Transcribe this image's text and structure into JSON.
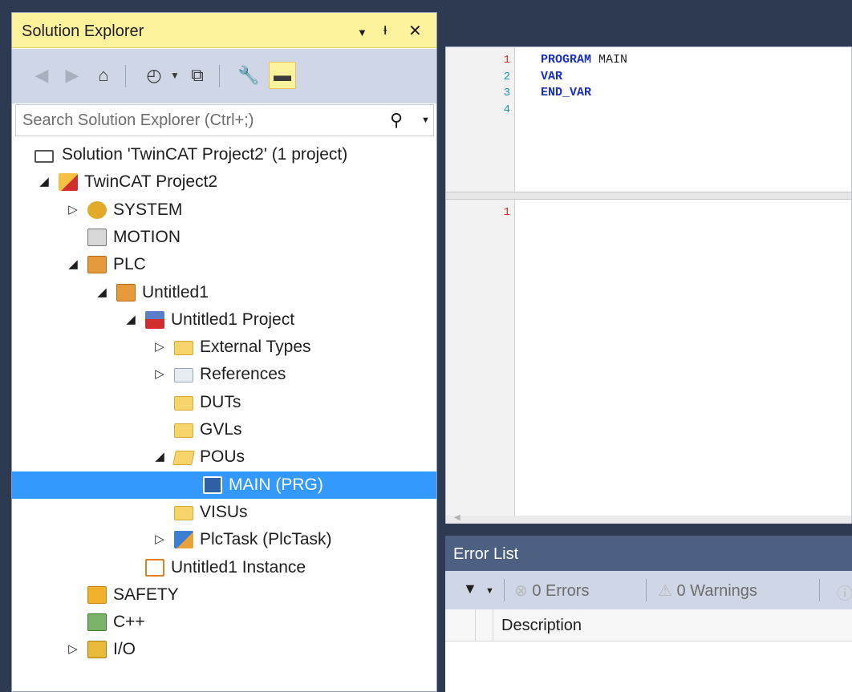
{
  "solution_explorer": {
    "title": "Solution Explorer",
    "search": {
      "placeholder": "Search Solution Explorer (Ctrl+;)"
    },
    "tree": [
      {
        "label": "Solution 'TwinCAT Project2' (1 project)",
        "icon": "solution-icon",
        "expander": ""
      },
      {
        "label": "TwinCAT Project2",
        "icon": "twincat-project-icon",
        "expander": "◢"
      },
      {
        "label": "SYSTEM",
        "icon": "system-icon",
        "expander": "▷"
      },
      {
        "label": "MOTION",
        "icon": "motion-icon",
        "expander": ""
      },
      {
        "label": "PLC",
        "icon": "plc-icon",
        "expander": "◢"
      },
      {
        "label": "Untitled1",
        "icon": "plc-project-icon",
        "expander": "◢"
      },
      {
        "label": "Untitled1 Project",
        "icon": "plc-nested-project-icon",
        "expander": "◢"
      },
      {
        "label": "External Types",
        "icon": "folder-icon",
        "expander": "▷"
      },
      {
        "label": "References",
        "icon": "references-icon",
        "expander": "▷"
      },
      {
        "label": "DUTs",
        "icon": "folder-icon",
        "expander": ""
      },
      {
        "label": "GVLs",
        "icon": "folder-icon",
        "expander": ""
      },
      {
        "label": "POUs",
        "icon": "folder-open-icon",
        "expander": "◢"
      },
      {
        "label": "MAIN (PRG)",
        "icon": "pou-icon",
        "expander": "",
        "selected": true
      },
      {
        "label": "VISUs",
        "icon": "folder-icon",
        "expander": ""
      },
      {
        "label": "PlcTask (PlcTask)",
        "icon": "task-icon",
        "expander": "▷"
      },
      {
        "label": "Untitled1 Instance",
        "icon": "instance-icon",
        "expander": ""
      },
      {
        "label": "SAFETY",
        "icon": "safety-icon",
        "expander": ""
      },
      {
        "label": "C++",
        "icon": "cpp-icon",
        "expander": ""
      },
      {
        "label": "I/O",
        "icon": "io-icon",
        "expander": "▷"
      }
    ]
  },
  "editor": {
    "declaration_lines": [
      {
        "num": "1",
        "kw": "PROGRAM",
        "rest": " MAIN"
      },
      {
        "num": "2",
        "kw": "VAR",
        "rest": ""
      },
      {
        "num": "3",
        "kw": "END_VAR",
        "rest": ""
      },
      {
        "num": "4",
        "kw": "",
        "rest": ""
      }
    ],
    "implementation_lines": [
      {
        "num": "1"
      }
    ]
  },
  "error_list": {
    "title": "Error List",
    "errors_label": "0 Errors",
    "warnings_label": "0 Warnings",
    "column_description": "Description"
  },
  "colors": {
    "selection": "#3399ff",
    "title_bar_active": "#fff29d",
    "background": "#2d3a52",
    "keyword": "#1b2fbf"
  }
}
